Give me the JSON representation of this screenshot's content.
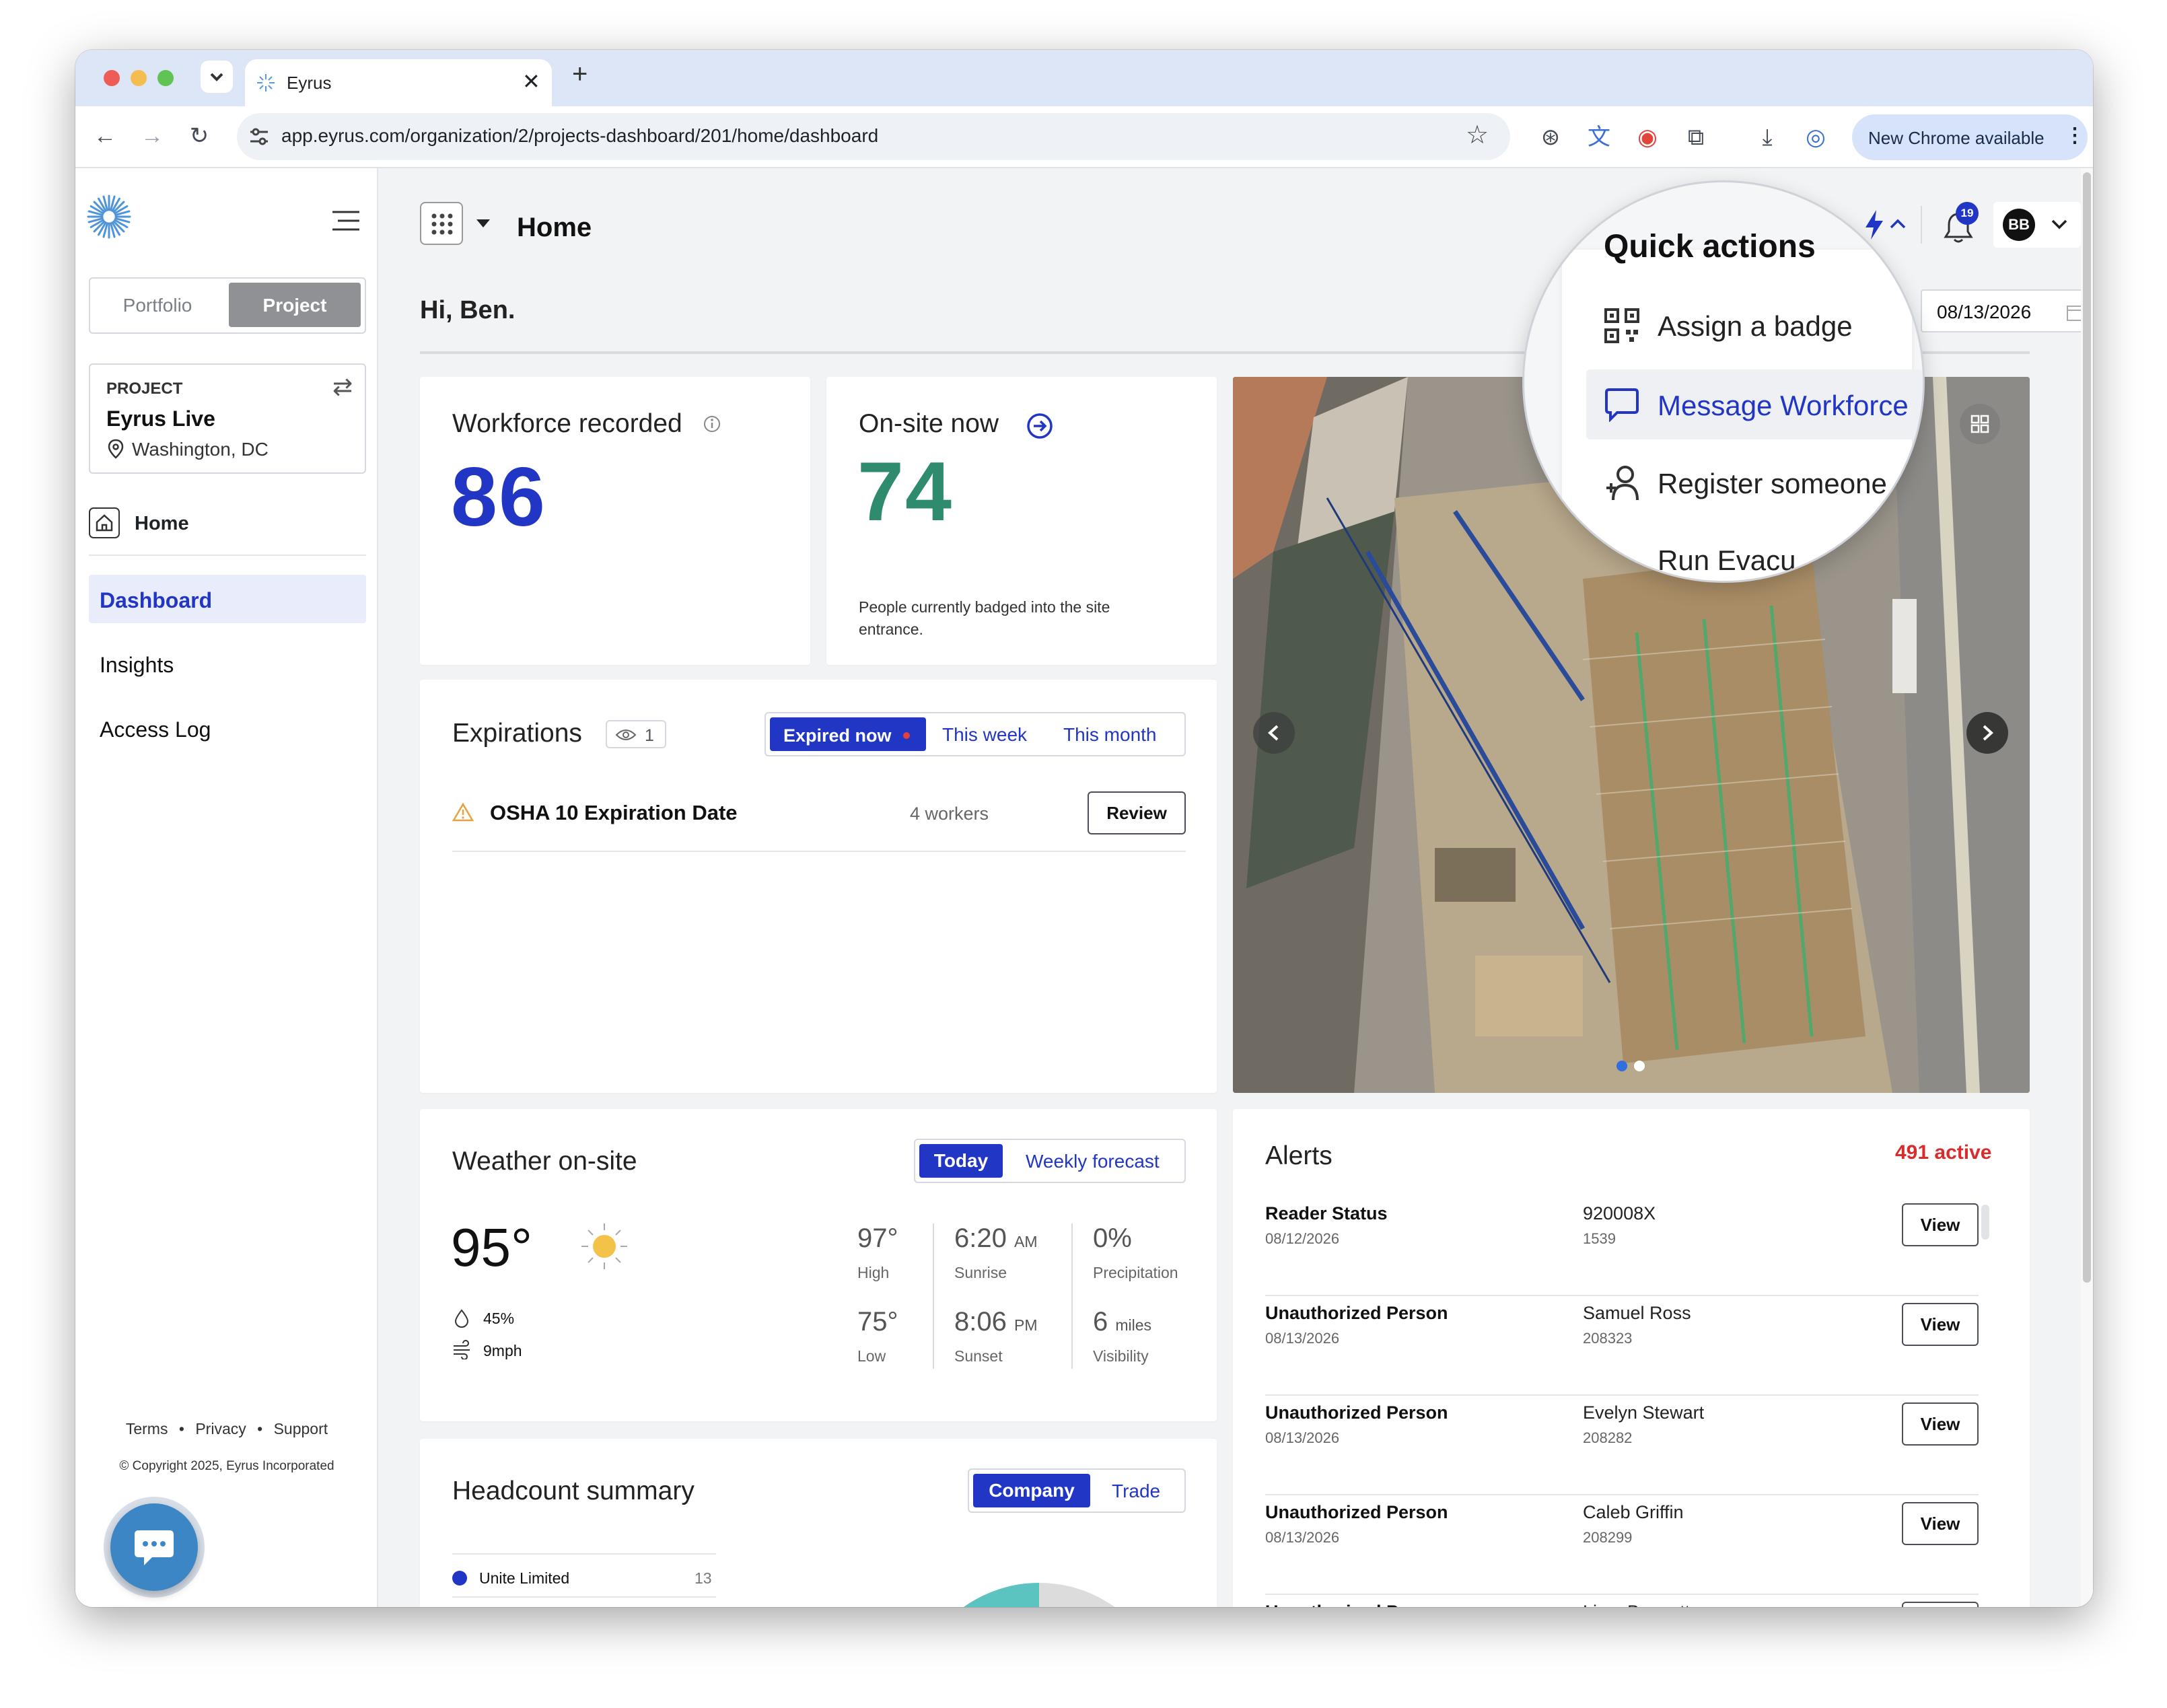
{
  "browser": {
    "tab_title": "Eyrus",
    "url": "app.eyrus.com/organization/2/projects-dashboard/201/home/dashboard",
    "update_button": "New Chrome available"
  },
  "sidebar": {
    "toggle": {
      "portfolio": "Portfolio",
      "project": "Project"
    },
    "project": {
      "label": "PROJECT",
      "name": "Eyrus Live",
      "location": "Washington, DC"
    },
    "home_label": "Home",
    "nav": [
      {
        "label": "Dashboard"
      },
      {
        "label": "Insights"
      },
      {
        "label": "Access Log"
      }
    ],
    "footer": {
      "links": [
        "Terms",
        "Privacy",
        "Support"
      ],
      "copyright": "© Copyright 2025, Eyrus Incorporated"
    }
  },
  "header": {
    "title": "Home",
    "notifications_count": "19",
    "avatar_initials": "BB"
  },
  "greeting": "Hi, Ben.",
  "date_value": "08/13/2026",
  "quick_actions": {
    "title": "Quick actions",
    "items": [
      {
        "label": "Assign a badge"
      },
      {
        "label": "Message Workforce"
      },
      {
        "label": "Register someone"
      },
      {
        "label": "Run Evacu"
      }
    ]
  },
  "workforce": {
    "title": "Workforce recorded",
    "value": "86"
  },
  "onsite": {
    "title": "On-site now",
    "value": "74",
    "description": "People currently badged into the site entrance."
  },
  "expirations": {
    "title": "Expirations",
    "count": "1",
    "tabs": [
      "Expired now",
      "This week",
      "This month"
    ],
    "items": [
      {
        "name": "OSHA 10 Expiration Date",
        "count": "4 workers",
        "action": "Review"
      }
    ]
  },
  "weather": {
    "title": "Weather on-site",
    "tabs": [
      "Today",
      "Weekly forecast"
    ],
    "temp": "95°",
    "humidity": "45%",
    "wind": "9mph",
    "high": {
      "value": "97°",
      "label": "High"
    },
    "low": {
      "value": "75°",
      "label": "Low"
    },
    "sunrise": {
      "value": "6:20",
      "suffix": "AM",
      "label": "Sunrise"
    },
    "sunset": {
      "value": "8:06",
      "suffix": "PM",
      "label": "Sunset"
    },
    "precipitation": {
      "value": "0%",
      "label": "Precipitation"
    },
    "visibility": {
      "value": "6",
      "suffix": "miles",
      "label": "Visibility"
    }
  },
  "alerts": {
    "title": "Alerts",
    "active": "491 active",
    "items": [
      {
        "type": "Reader Status",
        "date": "08/12/2026",
        "subject": "920008X",
        "id": "1539",
        "action": "View"
      },
      {
        "type": "Unauthorized Person",
        "date": "08/13/2026",
        "subject": "Samuel Ross",
        "id": "208323",
        "action": "View"
      },
      {
        "type": "Unauthorized Person",
        "date": "08/13/2026",
        "subject": "Evelyn Stewart",
        "id": "208282",
        "action": "View"
      },
      {
        "type": "Unauthorized Person",
        "date": "08/13/2026",
        "subject": "Caleb Griffin",
        "id": "208299",
        "action": "View"
      },
      {
        "type": "Unauthorized Person",
        "date": "",
        "subject": "Liam Bennett",
        "id": "",
        "action": "View"
      }
    ]
  },
  "headcount": {
    "title": "Headcount summary",
    "tabs": [
      "Company",
      "Trade"
    ],
    "items": [
      {
        "name": "Unite Limited",
        "count": "13"
      }
    ]
  },
  "colors": {
    "accent": "#2136c4",
    "green": "#2e8b6e",
    "alert_red": "#d92d2d",
    "teal": "#5bc4c0"
  }
}
